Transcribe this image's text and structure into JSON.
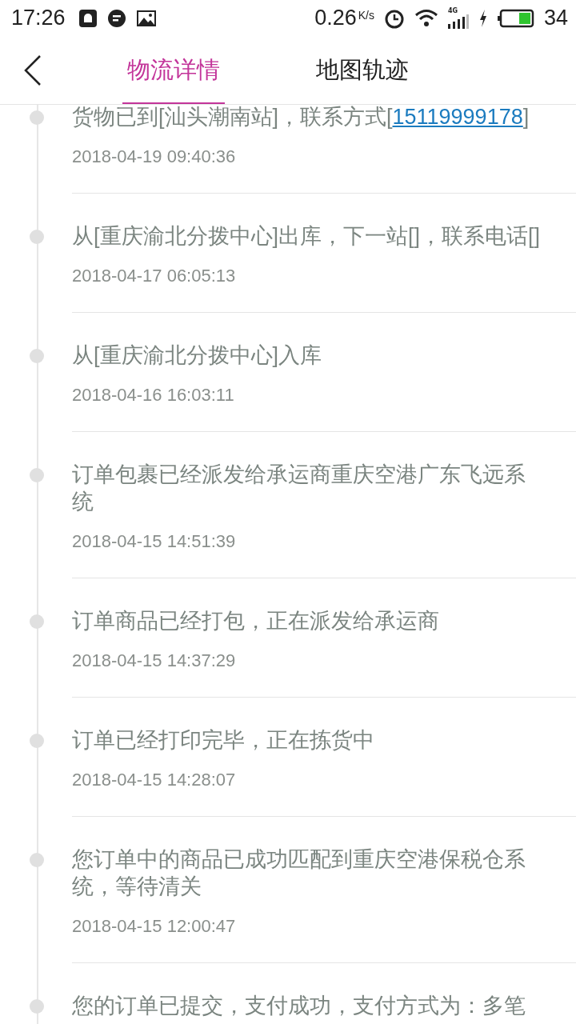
{
  "status_bar": {
    "time": "17:26",
    "speed": "0.26",
    "speed_unit": "K/s",
    "network": "4G",
    "battery": "34"
  },
  "header": {
    "tabs": [
      {
        "label": "物流详情",
        "selected": true
      },
      {
        "label": "地图轨迹",
        "selected": false
      }
    ]
  },
  "events": [
    {
      "text": "货物已到[汕头潮南站]，联系方式[",
      "link": "15119999178",
      "text_after": "]",
      "time": "2018-04-19 09:40:36"
    },
    {
      "text": "从[重庆渝北分拨中心]出库，下一站[]，联系电话[]",
      "time": "2018-04-17 06:05:13"
    },
    {
      "text": "从[重庆渝北分拨中心]入库",
      "time": "2018-04-16 16:03:11"
    },
    {
      "text": "订单包裹已经派发给承运商重庆空港广东飞远系统",
      "time": "2018-04-15 14:51:39"
    },
    {
      "text": "订单商品已经打包，正在派发给承运商",
      "time": "2018-04-15 14:37:29"
    },
    {
      "text": "订单已经打印完毕，正在拣货中",
      "time": "2018-04-15 14:28:07"
    },
    {
      "text": "您订单中的商品已成功匹配到重庆空港保税仓系统，等待清关",
      "time": "2018-04-15 12:00:47"
    },
    {
      "text": "您的订单已提交，支付成功，支付方式为：多笔"
    }
  ]
}
